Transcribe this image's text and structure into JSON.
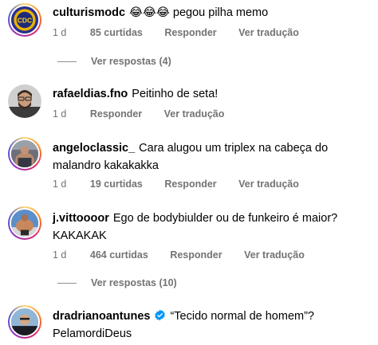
{
  "comments": [
    {
      "username": "culturismodc",
      "text": "😂😂😂 pegou pilha memo",
      "time": "1 d",
      "likes": "85 curtidas",
      "reply": "Responder",
      "translate": "Ver tradução",
      "view_replies": "Ver respostas (4)",
      "avatar_badge": "CDC"
    },
    {
      "username": "rafaeldias.fno",
      "text": "Peitinho de seta!",
      "time": "1 d",
      "reply": "Responder",
      "translate": "Ver tradução"
    },
    {
      "username": "angeloclassic_",
      "text": "Cara alugou um triplex na cabeça do malandro kakakakka",
      "time": "1 d",
      "likes": "19 curtidas",
      "reply": "Responder",
      "translate": "Ver tradução"
    },
    {
      "username": "j.vittoooor",
      "text": "Ego de bodybiulder ou de funkeiro é maior? KAKAKAK",
      "time": "1 d",
      "likes": "464 curtidas",
      "reply": "Responder",
      "translate": "Ver tradução",
      "view_replies": "Ver respostas (10)"
    },
    {
      "username": "dradrianoantunes",
      "verified": true,
      "text": "“Tecido normal de homem”? PelamordiDeus"
    }
  ],
  "colors": {
    "meta_gray": "#737373",
    "verified_blue": "#0095f6"
  }
}
